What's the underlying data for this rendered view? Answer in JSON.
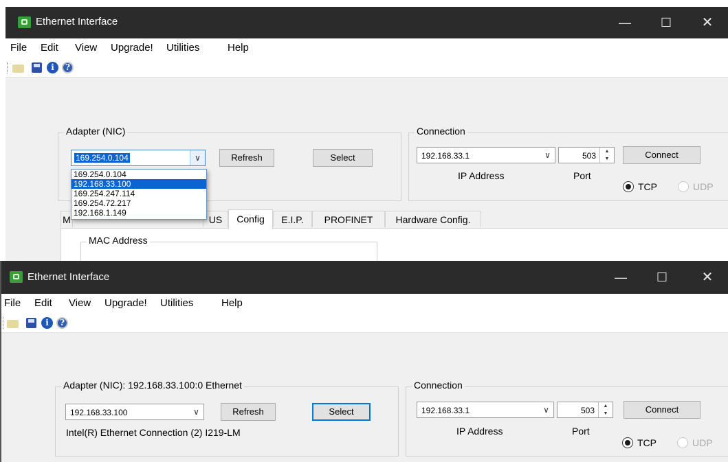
{
  "top_window": {
    "title": "Ethernet Interface",
    "controls": {
      "minimize": "—",
      "maximize": "☐",
      "close": "✕"
    },
    "menu": [
      "File",
      "Edit",
      "View",
      "Upgrade!",
      "Utilities",
      "Help"
    ],
    "toolbar_icons": [
      "open-folder-icon",
      "save-icon",
      "info-icon",
      "help-icon"
    ],
    "adapter": {
      "legend": "Adapter (NIC)",
      "selected": "169.254.0.104",
      "options": [
        "169.254.0.104",
        "192.168.33.100",
        "169.254.247.114",
        "169.254.72.217",
        "192.168.1.149"
      ],
      "highlighted": "192.168.33.100",
      "refresh": "Refresh",
      "select": "Select"
    },
    "connection": {
      "legend": "Connection",
      "ip": "192.168.33.1",
      "ip_label": "IP Address",
      "port": "503",
      "port_label": "Port",
      "connect": "Connect",
      "tcp": "TCP",
      "udp": "UDP"
    },
    "tabs": {
      "partial_left": "M",
      "partial_us": "US",
      "items": [
        "Config",
        "E.I.P.",
        "PROFINET",
        "Hardware Config."
      ],
      "active": "Config"
    },
    "mac_group": "MAC Address"
  },
  "bottom_window": {
    "title": "Ethernet Interface",
    "controls": {
      "minimize": "—",
      "maximize": "☐",
      "close": "✕"
    },
    "menu": [
      "File",
      "Edit",
      "View",
      "Upgrade!",
      "Utilities",
      "Help"
    ],
    "adapter": {
      "legend": "Adapter (NIC): 192.168.33.100:0 Ethernet",
      "selected": "192.168.33.100",
      "description": "Intel(R) Ethernet Connection (2) I219-LM",
      "refresh": "Refresh",
      "select": "Select"
    },
    "connection": {
      "legend": "Connection",
      "ip": "192.168.33.1",
      "ip_label": "IP Address",
      "port": "503",
      "port_label": "Port",
      "connect": "Connect",
      "tcp": "TCP",
      "udp": "UDP"
    }
  },
  "arrows": {
    "down": "∨",
    "spin_up": "▲",
    "spin_down": "▼"
  },
  "colors": {
    "titlebar": "#2b2b2b",
    "selection": "#0a64d2",
    "focus_border": "#0078d7"
  }
}
